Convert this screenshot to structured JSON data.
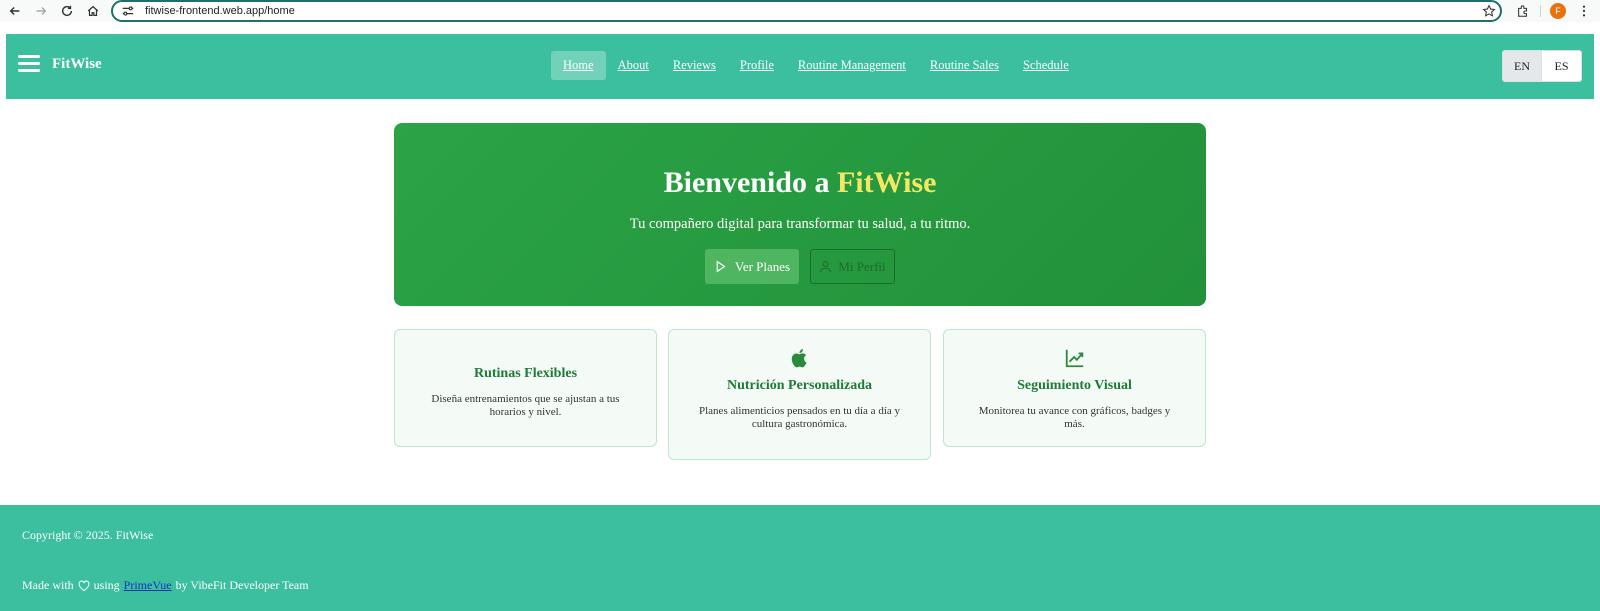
{
  "browser": {
    "url": "fitwise-frontend.web.app/home",
    "profile_initial": "F",
    "icons": [
      "back-icon",
      "forward-icon",
      "reload-icon",
      "home-icon",
      "tune-icon",
      "star-icon",
      "extensions-icon",
      "kebab-icon"
    ]
  },
  "header": {
    "brand": "FitWise",
    "nav": [
      {
        "label": "Home",
        "active": true
      },
      {
        "label": "About"
      },
      {
        "label": "Reviews"
      },
      {
        "label": "Profile"
      },
      {
        "label": "Routine Management"
      },
      {
        "label": "Routine Sales"
      },
      {
        "label": "Schedule"
      }
    ],
    "languages": [
      {
        "label": "EN",
        "selected": true
      },
      {
        "label": "ES"
      }
    ]
  },
  "hero": {
    "title_prefix": "Bienvenido a ",
    "title_accent": "FitWise",
    "subtitle": "Tu compañero digital para transformar tu salud, a tu ritmo.",
    "primary_button": "Ver Planes",
    "secondary_button": "Mi Perfil"
  },
  "features": [
    {
      "title": "Rutinas Flexibles",
      "text": "Diseña entrenamientos que se ajustan a tus horarios y nivel."
    },
    {
      "icon": "apple-icon",
      "title": "Nutrición Personalizada",
      "text": "Planes alimenticios pensados en tu día a día y cultura gastronómica."
    },
    {
      "icon": "chart-line-icon",
      "title": "Seguimiento Visual",
      "text": "Monitorea tu avance con gráficos, badges y más."
    }
  ],
  "footer": {
    "copyright": "Copyright © 2025. FitWise",
    "made_with_prefix": "Made with",
    "made_with_using": "using",
    "link_label": "PrimeVue",
    "made_with_suffix": "by VibeFit Developer Team"
  },
  "colors": {
    "header_bg": "#3cbf9e",
    "hero_bg": "#2ba346",
    "accent_yellow": "#f5e663",
    "card_title": "#1f7a35"
  }
}
